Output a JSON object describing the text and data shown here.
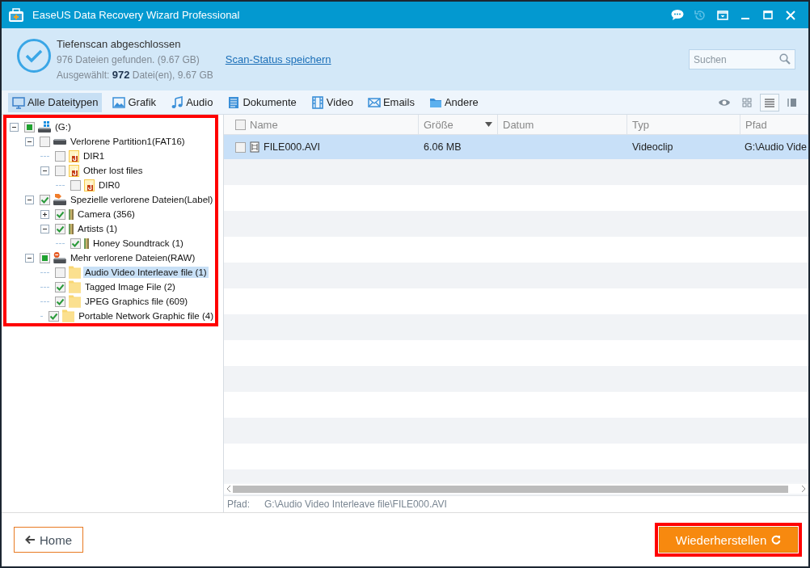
{
  "window": {
    "title": "EaseUS Data Recovery Wizard Professional"
  },
  "title_controls": [
    {
      "kind": "chat",
      "disabled": false
    },
    {
      "kind": "history",
      "disabled": true
    },
    {
      "kind": "menu",
      "disabled": false
    },
    {
      "kind": "minimize",
      "disabled": false
    },
    {
      "kind": "maximize",
      "disabled": false
    },
    {
      "kind": "close",
      "disabled": false
    }
  ],
  "scan_summary": {
    "status": "Tiefenscan abgeschlossen",
    "found": "976 Dateien gefunden. (9.67 GB)",
    "selected_info": "Ausgewählt: **972** Datei(en), 9.67 GB",
    "save_link": "Scan-Status speichern"
  },
  "search": {
    "placeholder": "Suchen"
  },
  "filter_tabs": [
    {
      "label": "Alle Dateitypen",
      "kind": "all",
      "selected": true
    },
    {
      "label": "Grafik",
      "kind": "image",
      "selected": false
    },
    {
      "label": "Audio",
      "kind": "audio",
      "selected": false
    },
    {
      "label": "Dokumente",
      "kind": "document",
      "selected": false
    },
    {
      "label": "Video",
      "kind": "video",
      "selected": false
    },
    {
      "label": "Emails",
      "kind": "email",
      "selected": false
    },
    {
      "label": "Andere",
      "kind": "other",
      "selected": false
    }
  ],
  "view_modes": [
    {
      "kind": "preview",
      "selected": false
    },
    {
      "kind": "thumbnails",
      "selected": false
    },
    {
      "kind": "list",
      "selected": true
    },
    {
      "kind": "details",
      "selected": false
    }
  ],
  "tree": {
    "highlighted": true,
    "items": [
      {
        "label": "(G:)",
        "kind": "drive",
        "checked": false,
        "partial": true,
        "selected": false,
        "expanded": true,
        "children": [
          {
            "label": "Verlorene Partition1(FAT16)",
            "kind": "partition",
            "checked": false,
            "partial": false,
            "selected": false,
            "expanded": true,
            "children": [
              {
                "label": "DIR1",
                "kind": "lost-folder",
                "checked": false,
                "partial": false,
                "selected": false
              },
              {
                "label": "Other lost files",
                "kind": "lost-folder",
                "checked": false,
                "partial": false,
                "selected": false,
                "expanded": true,
                "children": [
                  {
                    "label": "DIR0",
                    "kind": "lost-folder",
                    "checked": false,
                    "partial": false,
                    "selected": false
                  }
                ]
              }
            ]
          },
          {
            "label": "Spezielle verlorene Dateien(Label)",
            "kind": "label-drive",
            "checked": true,
            "partial": false,
            "selected": false,
            "expanded": true,
            "children": [
              {
                "label": "Camera (356)",
                "kind": "label-folder",
                "checked": true,
                "partial": false,
                "selected": false,
                "expanded": false
              },
              {
                "label": "Artists (1)",
                "kind": "label-folder",
                "checked": true,
                "partial": false,
                "selected": false,
                "expanded": true,
                "children": [
                  {
                    "label": "Honey Soundtrack (1)",
                    "kind": "label-folder",
                    "checked": true,
                    "partial": false,
                    "selected": false
                  }
                ]
              }
            ]
          },
          {
            "label": "Mehr verlorene Dateien(RAW)",
            "kind": "raw-drive",
            "checked": false,
            "partial": true,
            "selected": false,
            "expanded": true,
            "children": [
              {
                "label": "Audio Video Interleave file (1)",
                "kind": "folder",
                "checked": false,
                "partial": false,
                "selected": true
              },
              {
                "label": "Tagged Image File (2)",
                "kind": "folder",
                "checked": true,
                "partial": false,
                "selected": false
              },
              {
                "label": "JPEG Graphics file (609)",
                "kind": "folder",
                "checked": true,
                "partial": false,
                "selected": false
              },
              {
                "label": "Portable Network Graphic file (4)",
                "kind": "folder",
                "checked": true,
                "partial": false,
                "selected": false
              }
            ]
          }
        ]
      }
    ]
  },
  "table": {
    "select_all": {
      "checked": false
    },
    "columns": [
      {
        "label": "Name",
        "sorted": false
      },
      {
        "label": "Größe",
        "sorted": true
      },
      {
        "label": "Datum",
        "sorted": false
      },
      {
        "label": "Typ",
        "sorted": false
      },
      {
        "label": "Pfad",
        "sorted": false
      }
    ],
    "rows": [
      {
        "checked": false,
        "selected": true,
        "name": "FILE000.AVI",
        "size": "6.06 MB",
        "type": "Videoclip",
        "path": "G:\\Audio Vide"
      }
    ]
  },
  "path_bar": {
    "label": "Pfad:",
    "value": "G:\\Audio Video Interleave file\\FILE000.AVI"
  },
  "home_button": {
    "label": "Home"
  },
  "recover_button": {
    "label": "Wiederherstellen",
    "highlighted": true
  }
}
